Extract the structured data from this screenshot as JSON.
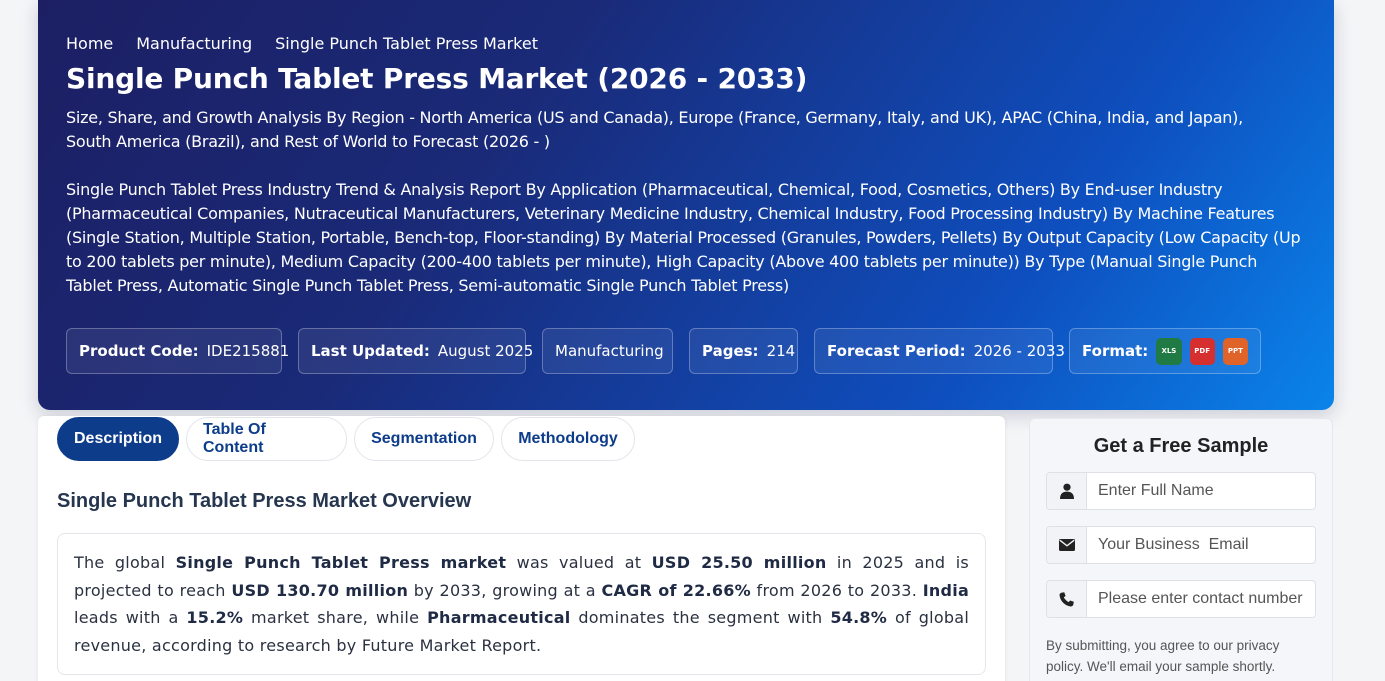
{
  "breadcrumb": [
    "Home",
    "Manufacturing",
    "Single Punch Tablet Press Market"
  ],
  "hero": {
    "title": "Single Punch Tablet Press Market (2026 - 2033)",
    "subtitle": "Size, Share, and Growth Analysis By Region - North America (US and Canada), Europe (France, Germany, Italy, and UK), APAC (China, India, and Japan), South America (Brazil), and Rest of World to Forecast (2026 - )",
    "description": "Single Punch Tablet Press Industry Trend & Analysis Report By Application (Pharmaceutical, Chemical, Food, Cosmetics, Others) By End-user Industry (Pharmaceutical Companies, Nutraceutical Manufacturers, Veterinary Medicine Industry, Chemical Industry, Food Processing Industry) By Machine Features (Single Station, Multiple Station, Portable, Bench-top, Floor-standing) By Material Processed (Granules, Powders, Pellets) By Output Capacity (Low Capacity (Up to 200 tablets per minute), Medium Capacity (200-400 tablets per minute), High Capacity (Above 400 tablets per minute)) By Type (Manual Single Punch Tablet Press, Automatic Single Punch Tablet Press, Semi-automatic Single Punch Tablet Press)"
  },
  "meta": {
    "product_code_label": "Product Code:",
    "product_code": "IDE215881",
    "last_updated_label": "Last Updated:",
    "last_updated": "August 2025",
    "category": "Manufacturing",
    "pages_label": "Pages:",
    "pages": "214",
    "forecast_label": "Forecast Period:",
    "forecast": "2026 - 2033",
    "format_label": "Format:",
    "formats": [
      "XLS",
      "PDF",
      "PPT"
    ]
  },
  "tabs": [
    {
      "label": "Description",
      "active": true
    },
    {
      "label": "Table Of Content",
      "active": false
    },
    {
      "label": "Segmentation",
      "active": false
    },
    {
      "label": "Methodology",
      "active": false
    }
  ],
  "overview": {
    "title": "Single Punch Tablet Press Market Overview",
    "t1": "The global ",
    "b1": "Single Punch Tablet Press market",
    "t2": " was valued at ",
    "b2": "USD 25.50 million",
    "t3": " in 2025 and is projected to reach ",
    "b3": "USD 130.70 million",
    "t4": " by 2033, growing at a ",
    "b4": "CAGR of 22.66%",
    "t5": " from 2026 to 2033. ",
    "b5": "India",
    "t6": " leads with a ",
    "b6": "15.2%",
    "t7": " market share, while ",
    "b7": "Pharmaceutical",
    "t8": " dominates the segment with ",
    "b8": "54.8%",
    "t9": " of global revenue, according to research by Future Market Report."
  },
  "sample_form": {
    "title": "Get a Free Sample",
    "name_placeholder": "Enter Full Name",
    "email_placeholder": "Your Business  Email",
    "phone_placeholder": "Please enter contact number",
    "privacy": "By submitting, you agree to our privacy policy. We'll email your sample shortly."
  }
}
